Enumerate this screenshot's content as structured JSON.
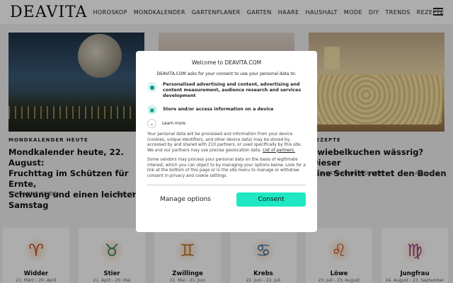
{
  "header": {
    "logo": "DEAVITA",
    "nav": [
      "HOROSKOP",
      "MONDKALENDER",
      "GARTENPLANER",
      "GARTEN",
      "HAARE",
      "HAUSHALT",
      "MODE",
      "DIY",
      "TRENDS",
      "REZEPTE"
    ],
    "menu_icon": "hamburger-menu-icon"
  },
  "articles": [
    {
      "kicker": "MONDKALENDER HEUTE",
      "title_lines": [
        "Mondkalender heute, 22. August:",
        "Fruchttag im Schützen für Ernte,",
        "Schwung und einen leichten",
        "Samstag"
      ],
      "author_prefix": "VON",
      "author": "ANNE SEIDEL",
      "date": "August 22"
    },
    {
      "kicker": "REZEPTE",
      "title_lines": [
        "Zwiebelkuchen wässrig? Dieser",
        "eine Schritt rettet den Boden"
      ],
      "author_prefix": "VON",
      "author": "KATHARINA MÜLLER",
      "date": "August 21"
    }
  ],
  "zodiac": [
    {
      "name": "Widder",
      "dates": "21. März - 20. April",
      "symbol": "♈"
    },
    {
      "name": "Stier",
      "dates": "21. April - 20. Mai",
      "symbol": "♉"
    },
    {
      "name": "Zwillinge",
      "dates": "21. Mai - 21. Juni",
      "symbol": "♊"
    },
    {
      "name": "Krebs",
      "dates": "22. Juni - 22. Juli",
      "symbol": "♋"
    },
    {
      "name": "Löwe",
      "dates": "23. Juli - 23. August",
      "symbol": "♌"
    },
    {
      "name": "Jungfrau",
      "dates": "24. August - 23. September",
      "symbol": "♍"
    }
  ],
  "consent": {
    "title": "Welcome to DEAVITA.COM",
    "intro": "DEAVITA.COM asks for your consent to use your personal data to:",
    "purpose1": "Personalised advertising and content, advertising and content measurement, audience research and services development",
    "purpose2": "Store and/or access information on a device",
    "learn_more": "Learn more",
    "para1": "Your personal data will be processed and information from your device (cookies, unique identifiers, and other device data) may be stored by, accessed by and shared with 210 partners, or used specifically by this site. We and our partners may use precise geolocation data.",
    "partners_link": "List of partners.",
    "para2": "Some vendors may process your personal data on the basis of legitimate interest, which you can object to by managing your options below. Look for a link at the bottom of this page or in the site menu to manage or withdraw consent in privacy and cookie settings.",
    "manage_label": "Manage options",
    "consent_label": "Consent",
    "accent_color": "#1fe7c3"
  }
}
